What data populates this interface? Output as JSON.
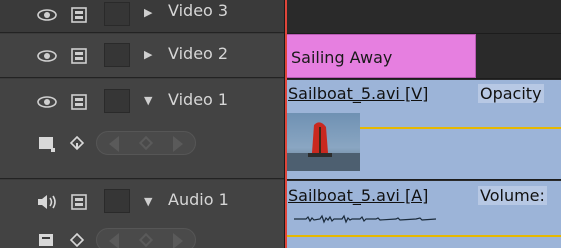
{
  "tracks": [
    {
      "name": "Video 3",
      "expanded": false
    },
    {
      "name": "Video 2",
      "expanded": false
    },
    {
      "name": "Video 1",
      "expanded": true
    },
    {
      "name": "Audio 1",
      "expanded": true
    }
  ],
  "clips": {
    "title_clip": "Sailing Away",
    "video1_clip": "Sailboat_5.avi [V]",
    "video1_effect": "Opacity",
    "audio1_clip": "Sailboat_5.avi [A]",
    "audio1_effect": "Volume:"
  },
  "colors": {
    "title_clip": "#e67fe0",
    "media_clip": "#9cb4d8",
    "rubber_band": "#e6b800",
    "playhead": "#e0453a"
  },
  "icons": {
    "visibility": "eye-icon",
    "audio": "speaker-icon",
    "sync_lock": "filmstrip-icon",
    "collapsed": "triangle-right-icon",
    "expanded": "triangle-down-icon",
    "keyframe_display": "keyframe-display-icon",
    "add_keyframe": "diamond-icon"
  }
}
